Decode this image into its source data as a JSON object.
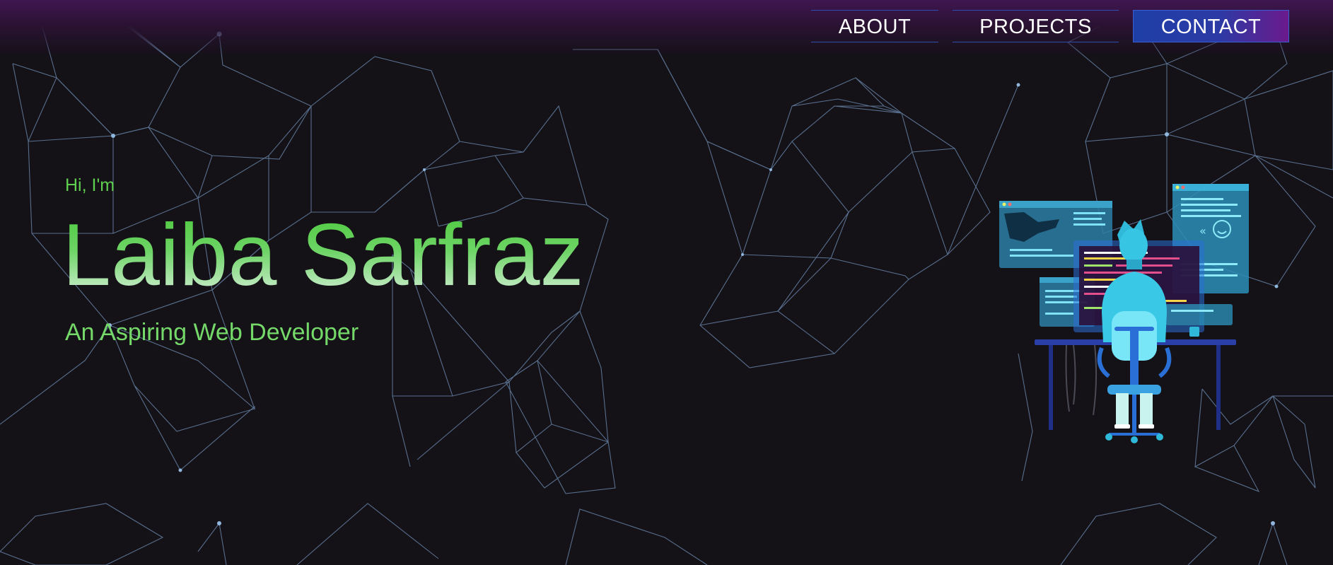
{
  "nav": {
    "items": [
      {
        "label": "ABOUT"
      },
      {
        "label": "PROJECTS"
      },
      {
        "label": "CONTACT"
      }
    ]
  },
  "hero": {
    "greeting": "Hi, I'm",
    "name": "Laiba Sarfraz",
    "tagline": "An Aspiring Web Developer"
  },
  "colors": {
    "background": "#141117",
    "header_gradient": "#3f1650",
    "accent_green": "#5ecf4f",
    "nav_border": "#2f4fb0",
    "contact_gradient_start": "#1e3fa6",
    "contact_gradient_end": "#6b1a8c",
    "network_lines": "#6f8fb5",
    "illustration_primary": "#2fb8d8"
  },
  "icons": {
    "background": "polygon-network-pattern",
    "illustration": "developer-at-desk-illustration"
  }
}
